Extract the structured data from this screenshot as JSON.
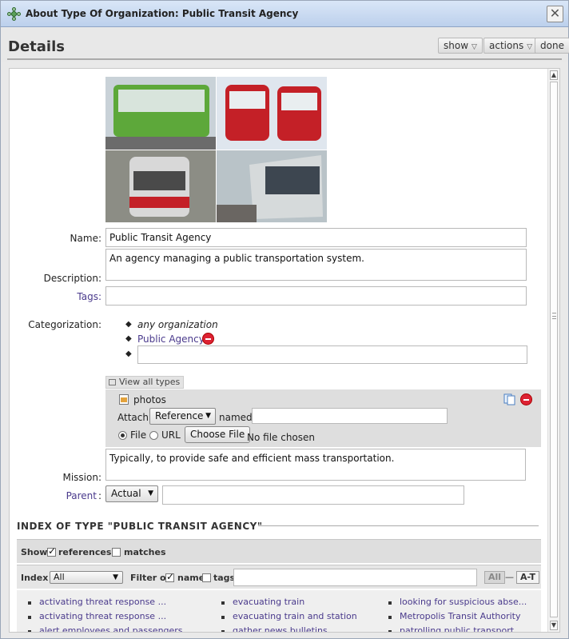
{
  "window": {
    "title": "About Type Of Organization: Public Transit Agency"
  },
  "header": {
    "title": "Details",
    "show_label": "show",
    "actions_label": "actions",
    "done_label": "done"
  },
  "form": {
    "name_label": "Name:",
    "name_value": "Public Transit Agency",
    "description_label": "Description:",
    "description_value": "An agency managing a public transportation system.",
    "tags_label": "Tags:",
    "tags_value": "",
    "categorization_label": "Categorization:",
    "categories": [
      "any organization",
      "Public Agency"
    ],
    "view_all_types": "View all types",
    "attachment": {
      "name": "photos",
      "attach_label": "Attach:",
      "attach_type": "Reference",
      "named_label": "named",
      "named_value": "",
      "file_label": "File",
      "url_label": "URL",
      "choose_file": "Choose File",
      "no_file": "No file chosen"
    },
    "mission_label": "Mission:",
    "mission_value": "Typically, to provide safe and efficient mass transportation.",
    "parent_label": "Parent",
    "parent_type": "Actual",
    "parent_value": ""
  },
  "index": {
    "heading": "INDEX OF TYPE  \"PUBLIC TRANSIT AGENCY\"",
    "show_label": "Show",
    "references_label": "references",
    "references_checked": true,
    "matches_label": "matches",
    "matches_checked": false,
    "index_label": "Index",
    "index_select": "All",
    "filter_on_label": "Filter on",
    "name_filter_label": "name",
    "tags_filter_label": "tags",
    "filter_value": "",
    "all_button": "All",
    "dash": "—",
    "az_button": "A-T",
    "col1": [
      "activating threat response ...",
      "activating threat response ...",
      "alert employees and passengers"
    ],
    "col2": [
      "evacuating train",
      "evacuating train and station",
      "gather news bulletins"
    ],
    "col3": [
      "looking for suspicious abse...",
      "Metropolis Transit Authority",
      "patrolling public transport"
    ]
  }
}
